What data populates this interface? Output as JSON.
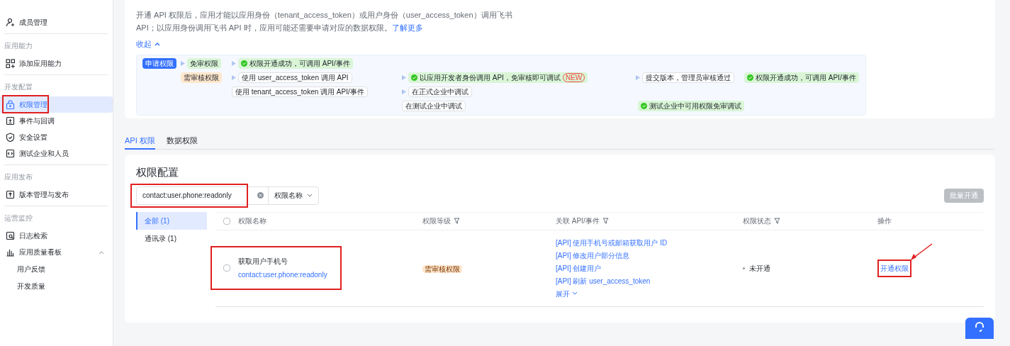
{
  "sidebar": {
    "items": [
      {
        "kind": "item",
        "label": "成员管理",
        "selected": false,
        "highlighted": false
      },
      {
        "kind": "section",
        "label": "应用能力"
      },
      {
        "kind": "item",
        "label": "添加应用能力",
        "selected": false,
        "highlighted": false
      },
      {
        "kind": "section",
        "label": "开发配置"
      },
      {
        "kind": "item",
        "label": "权限管理",
        "selected": true,
        "highlighted": true
      },
      {
        "kind": "item",
        "label": "事件与回调",
        "selected": false,
        "highlighted": false
      },
      {
        "kind": "item",
        "label": "安全设置",
        "selected": false,
        "highlighted": false
      },
      {
        "kind": "item",
        "label": "测试企业和人员",
        "selected": false,
        "highlighted": false
      },
      {
        "kind": "section",
        "label": "应用发布"
      },
      {
        "kind": "item",
        "label": "版本管理与发布",
        "selected": false,
        "highlighted": false
      },
      {
        "kind": "section",
        "label": "运营监控"
      },
      {
        "kind": "item",
        "label": "日志检索",
        "selected": false,
        "highlighted": false
      },
      {
        "kind": "group",
        "label": "应用质量看板",
        "expanded": true,
        "children": [
          {
            "label": "用户反馈"
          },
          {
            "label": "开发质量"
          }
        ]
      }
    ]
  },
  "intro": {
    "text": "开通 API 权限后，应用才能以应用身份（tenant_access_token）或用户身份（user_access_token）调用飞书 API；以应用身份调用飞书 API 时，应用可能还需要申请对应的数据权限。",
    "link": "了解更多",
    "collapse": "收起"
  },
  "diagram": {
    "rows": [
      {
        "nodes": [
          {
            "kind": "start",
            "text": "申请权限"
          },
          {
            "kind": "free",
            "text": "免审权限"
          },
          {
            "kind": "success",
            "text": "权限开通成功，可调用 API/事件"
          }
        ]
      },
      {
        "nodes": [
          {
            "kind": "gap"
          },
          {
            "kind": "review",
            "text": "需审核权限"
          },
          {
            "kind": "step",
            "text": "使用 user_access_token 调用 API"
          },
          {
            "kind": "success",
            "text": "以应用开发者身份调用 API，免审核即可调试",
            "badge": "NEW"
          },
          {
            "kind": "step",
            "text": "提交版本，管理员审核通过"
          },
          {
            "kind": "success",
            "text": "权限开通成功，可调用 API/事件"
          }
        ]
      },
      {
        "nodes": [
          {
            "kind": "gap"
          },
          {
            "kind": "gap"
          },
          {
            "kind": "step",
            "text": "使用 tenant_access_token 调用 API/事件"
          },
          {
            "kind": "step",
            "text": "在正式企业中调试"
          }
        ]
      },
      {
        "nodes": [
          {
            "kind": "gap"
          },
          {
            "kind": "gap"
          },
          {
            "kind": "gap"
          },
          {
            "kind": "step",
            "text": "在测试企业中调试"
          },
          {
            "kind": "success",
            "text": "测试企业中可用权限免审调试"
          }
        ]
      }
    ]
  },
  "tabs": [
    {
      "label": "API 权限",
      "selected": true
    },
    {
      "label": "数据权限",
      "selected": false
    }
  ],
  "panel": {
    "title": "权限配置",
    "search": {
      "value": "contact:user.phone:readonly",
      "highlighted": true
    },
    "search_type": "权限名称",
    "batch_button": {
      "label": "批量开通",
      "disabled": true
    },
    "categories": [
      {
        "label": "全部 (1)",
        "selected": true
      },
      {
        "label": "通讯录 (1)",
        "selected": false
      }
    ],
    "table": {
      "select_all_checked": false,
      "columns": [
        {
          "label": "权限名称",
          "filter": false
        },
        {
          "label": "权限等级",
          "filter": true
        },
        {
          "label": "关联 API/事件",
          "filter": true
        },
        {
          "label": "权限状态",
          "filter": true
        },
        {
          "label": "操作",
          "filter": false
        }
      ],
      "rows": [
        {
          "checked": false,
          "name": "获取用户手机号",
          "scope": "contact:user.phone:readonly",
          "name_highlighted": true,
          "level": "需审核权限",
          "apis": [
            "[API] 使用手机号或邮箱获取用户 ID",
            "[API] 修改用户部分信息",
            "[API] 创建用户",
            "[API] 刷新 user_access_token"
          ],
          "expand": "展开",
          "status": "未开通",
          "action": "开通权限",
          "action_highlighted": true,
          "action_arrow": true
        }
      ]
    }
  }
}
